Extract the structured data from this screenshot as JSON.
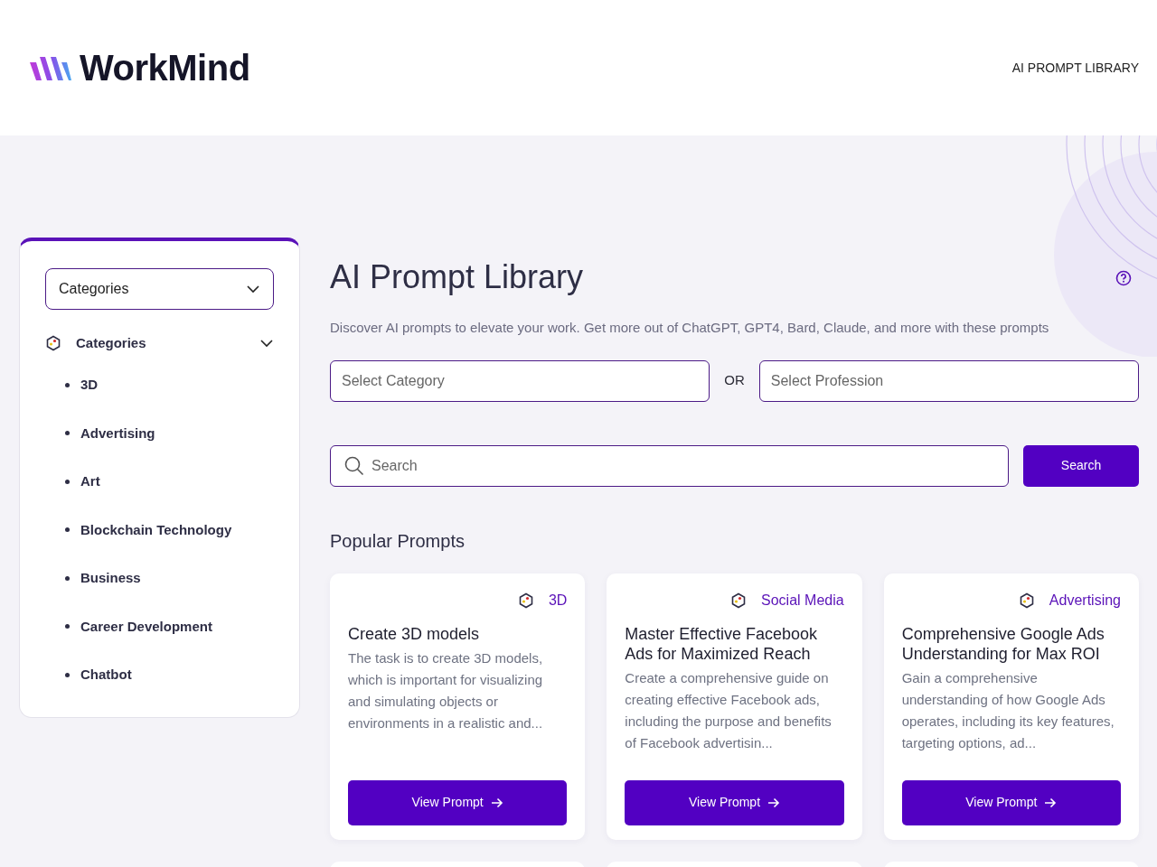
{
  "header": {
    "brand": "WorkMind",
    "nav": [
      {
        "label": "AI PROMPT LIBRARY"
      }
    ]
  },
  "sidebar": {
    "dropdown": {
      "value": "Categories"
    },
    "section": {
      "label": "Categories",
      "expanded": true,
      "items": [
        {
          "label": "3D"
        },
        {
          "label": "Advertising"
        },
        {
          "label": "Art"
        },
        {
          "label": "Blockchain Technology"
        },
        {
          "label": "Business"
        },
        {
          "label": "Career Development"
        },
        {
          "label": "Chatbot"
        }
      ]
    }
  },
  "main": {
    "title": "AI Prompt Library",
    "subtitle": "Discover AI prompts to elevate your work. Get more out of ChatGPT, GPT4, Bard, Claude, and more with these prompts",
    "category_select": {
      "placeholder": "Select Category"
    },
    "or": "OR",
    "profession_select": {
      "placeholder": "Select Profession"
    },
    "search": {
      "placeholder": "Search"
    },
    "search_button": "Search",
    "section_title": "Popular Prompts",
    "cards": [
      {
        "category": "3D",
        "title": "Create 3D models",
        "description": "The task is to create 3D models, which is important for visualizing and simulating objects or environments in a realistic and...",
        "button": "View Prompt"
      },
      {
        "category": "Social Media",
        "title": "Master Effective Facebook Ads for Maximized Reach",
        "description": "Create a comprehensive guide on creating effective Facebook ads, including the purpose and benefits of Facebook advertisin...",
        "button": "View Prompt"
      },
      {
        "category": "Advertising",
        "title": "Comprehensive Google Ads Understanding for Max ROI",
        "description": "Gain a comprehensive understanding of how Google Ads operates, including its key features, targeting options, ad...",
        "button": "View Prompt"
      }
    ],
    "more_cards": [
      {
        "kind": "card"
      },
      {
        "kind": "card"
      },
      {
        "kind": "card"
      }
    ]
  }
}
